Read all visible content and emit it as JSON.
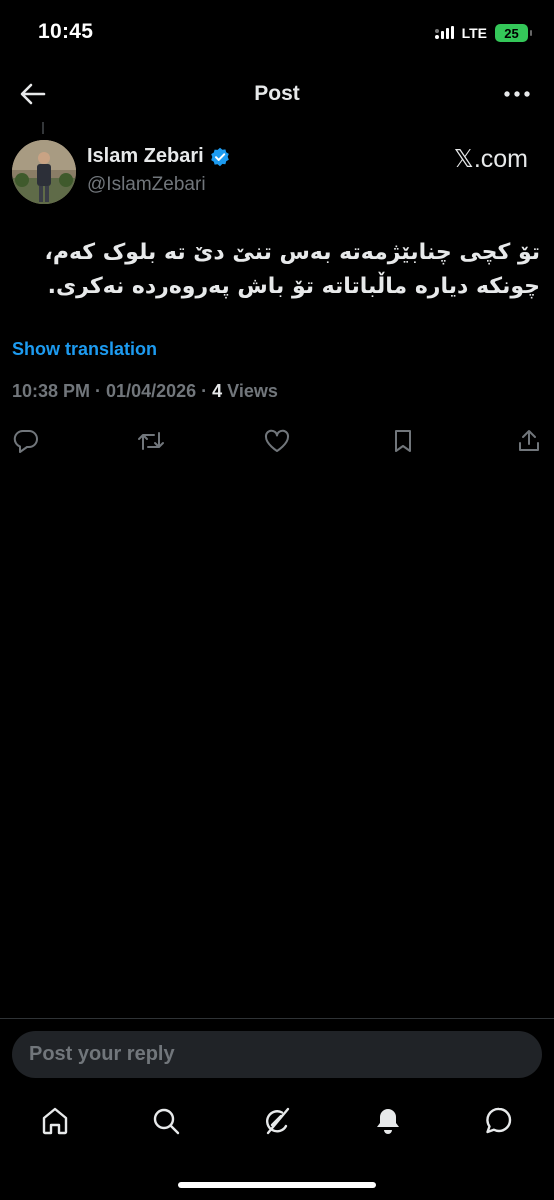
{
  "status_bar": {
    "time": "10:45",
    "network": "LTE",
    "battery": "25"
  },
  "header": {
    "title": "Post"
  },
  "author": {
    "name": "Islam Zebari",
    "handle": "@IslamZebari",
    "verified": true,
    "source_label": "𝕏.com"
  },
  "post": {
    "text_line1": "تۆ کچی چنابێژمەتە بەس تنێ دێ تە بلوک کەم،",
    "text_line2": "چونکە دیارە ماڵباتاتە تۆ باش پەروەردە نەکری.",
    "translate_label": "Show translation",
    "time": "10:38 PM",
    "date": "01/04/2026",
    "views_count": "4",
    "views_label": "Views"
  },
  "actions": [
    "reply-icon",
    "repost-icon",
    "like-icon",
    "bookmark-icon",
    "share-icon"
  ],
  "reply": {
    "placeholder": "Post your reply"
  },
  "nav": [
    "home-icon",
    "search-icon",
    "grok-icon",
    "notifications-icon",
    "messages-icon"
  ],
  "colors": {
    "accent": "#1d9bf0",
    "text": "#e7e9ea",
    "muted": "#71767b",
    "background": "#000000"
  }
}
